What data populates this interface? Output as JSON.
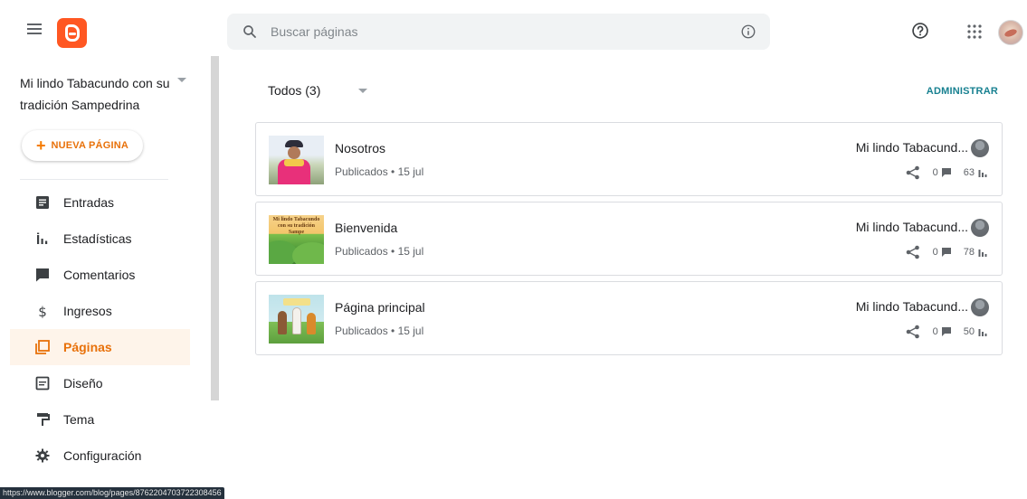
{
  "header": {
    "search_placeholder": "Buscar páginas"
  },
  "sidebar": {
    "blog_title": "Mi lindo Tabacundo con su tradición Sampedrina",
    "new_page_label": "NUEVA PÁGINA",
    "items": [
      {
        "label": "Entradas",
        "icon": "posts-icon"
      },
      {
        "label": "Estadísticas",
        "icon": "stats-icon"
      },
      {
        "label": "Comentarios",
        "icon": "comments-icon"
      },
      {
        "label": "Ingresos",
        "icon": "dollar-icon"
      },
      {
        "label": "Páginas",
        "icon": "pages-icon",
        "active": true
      },
      {
        "label": "Diseño",
        "icon": "layout-icon"
      },
      {
        "label": "Tema",
        "icon": "paint-roller-icon"
      },
      {
        "label": "Configuración",
        "icon": "gear-icon"
      }
    ]
  },
  "main": {
    "filter_label": "Todos (3)",
    "manage_label": "ADMINISTRAR",
    "pages": [
      {
        "title": "Nosotros",
        "status": "Publicados • 15 jul",
        "author": "Mi lindo Tabacund...",
        "comments": "0",
        "views": "63"
      },
      {
        "title": "Bienvenida",
        "status": "Publicados • 15 jul",
        "author": "Mi lindo Tabacund...",
        "comments": "0",
        "views": "78",
        "thumb_text": "Mi lindo Tabacundo con su tradición Sampe"
      },
      {
        "title": "Página principal",
        "status": "Publicados • 15 jul",
        "author": "Mi lindo Tabacund...",
        "comments": "0",
        "views": "50"
      }
    ]
  },
  "statusbar": {
    "url": "https://www.blogger.com/blog/pages/8762204703722308456"
  },
  "colors": {
    "accent": "#e8710a",
    "active_bg": "#fef4ea",
    "link": "#188191",
    "logo": "#ff5722"
  }
}
